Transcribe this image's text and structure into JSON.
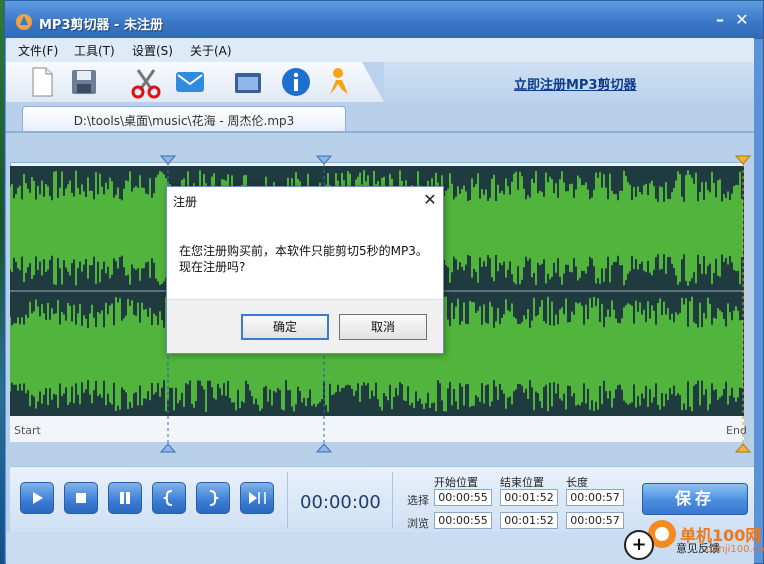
{
  "window": {
    "title": "MP3剪切器 - 未注册",
    "minimize_icon": "minimize-icon",
    "close_icon": "close-icon"
  },
  "menu": [
    {
      "label": "文件(F)"
    },
    {
      "label": "工具(T)"
    },
    {
      "label": "设置(S)"
    },
    {
      "label": "关于(A)"
    }
  ],
  "toolbar": {
    "icons": [
      "new-file-icon",
      "save-disk-icon",
      "scissors-icon",
      "email-icon",
      "window-icon",
      "info-icon",
      "person-icon"
    ],
    "register_link": "立即注册MP3剪切器"
  },
  "file_tab": {
    "label": "D:\\tools\\桌面\\music\\花海 - 周杰伦.mp3"
  },
  "waveform": {
    "start_label": "Start",
    "end_label": "End"
  },
  "dialog": {
    "title": "注册",
    "message_line1": "在您注册购买前，本软件只能剪切5秒的MP3。",
    "message_line2": "现在注册吗?",
    "ok_label": "确定",
    "cancel_label": "取消"
  },
  "playback": {
    "time": "00:00:00",
    "buttons": [
      "play-icon",
      "stop-icon",
      "pause-icon",
      "mark-start-icon",
      "mark-end-icon",
      "play-selection-icon"
    ]
  },
  "range": {
    "headers": {
      "start": "开始位置",
      "end": "结束位置",
      "length": "长度"
    },
    "select": {
      "label": "选择",
      "start": "00:00:55",
      "end": "00:01:52",
      "length": "00:00:57"
    },
    "preview": {
      "label": "浏览",
      "start": "00:00:55",
      "end": "00:01:52",
      "length": "00:00:57"
    }
  },
  "save_label": "保存",
  "feedback_label": "意见反馈",
  "watermark": {
    "text": "单机100网",
    "url": "danji100.com"
  },
  "colors": {
    "wave_green": "#5ed33b",
    "wave_bg": "#1f3b3f",
    "accent_blue": "#3b7dd4"
  }
}
